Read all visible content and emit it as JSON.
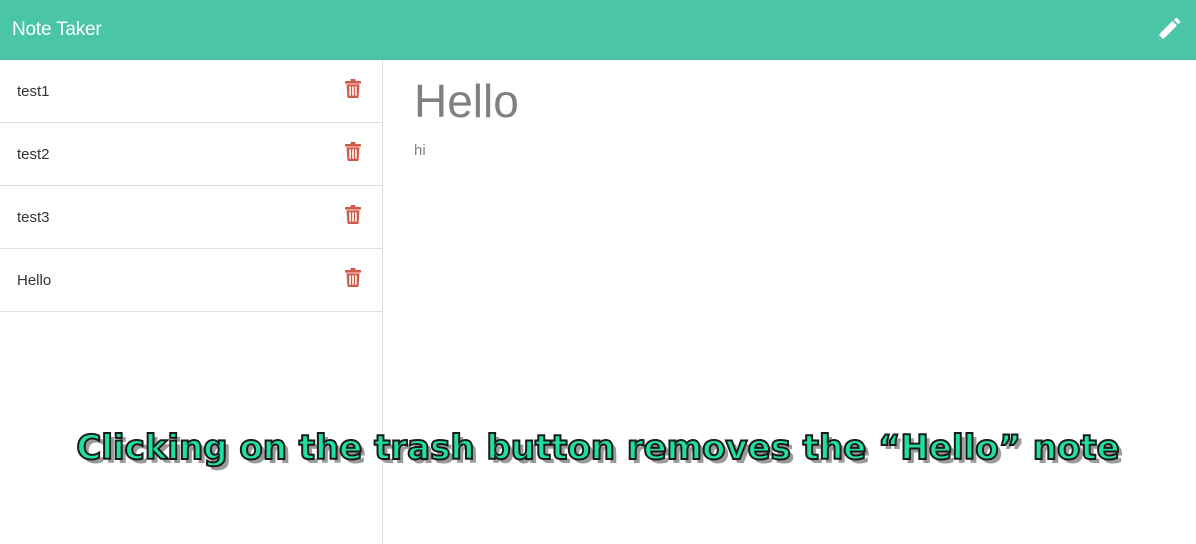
{
  "navbar": {
    "brand": "Note Taker",
    "new_note_icon": "pencil-icon",
    "bg_color": "#4ac5a8"
  },
  "sidebar": {
    "notes": [
      {
        "title": "test1",
        "delete_icon": "trash-icon"
      },
      {
        "title": "test2",
        "delete_icon": "trash-icon"
      },
      {
        "title": "test3",
        "delete_icon": "trash-icon"
      },
      {
        "title": "Hello",
        "delete_icon": "trash-icon"
      }
    ],
    "delete_color": "#d15b4b"
  },
  "editor": {
    "title": "Hello",
    "text": "hi"
  },
  "caption": {
    "text": "Clicking on the trash button removes the “Hello” note"
  }
}
